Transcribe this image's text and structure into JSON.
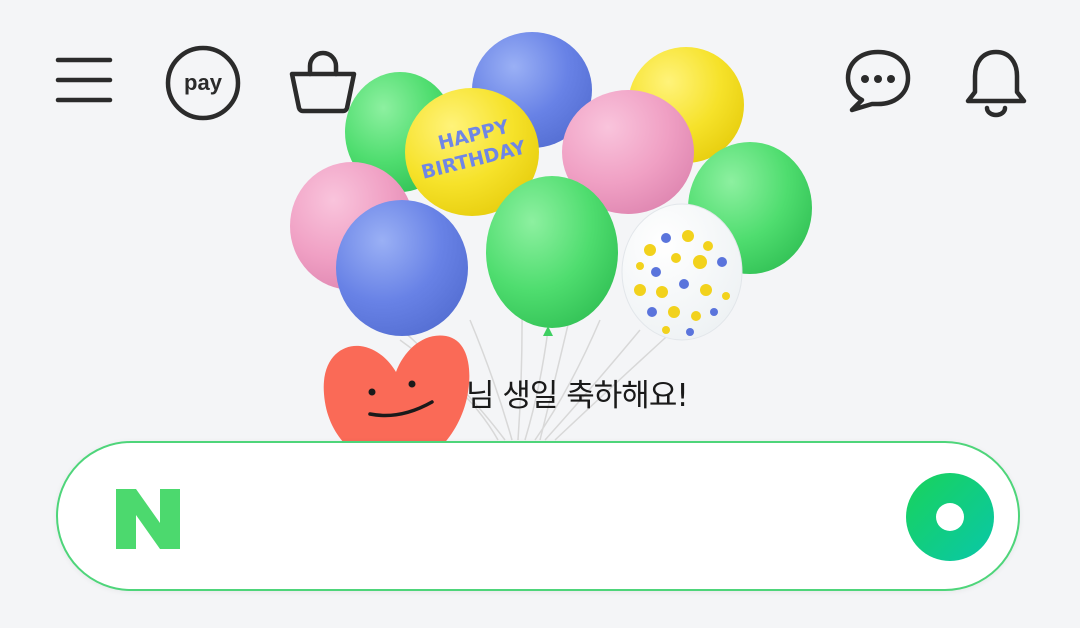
{
  "header": {
    "icons": [
      "menu-icon",
      "pay-icon",
      "shopping-bag-icon",
      "talk-bubble-icon",
      "bell-icon"
    ],
    "pay_label": "pay"
  },
  "banner": {
    "balloon_text": "HAPPY BIRTHDAY",
    "greeting": "님 생일 축하해요!"
  },
  "search": {
    "logo_letter": "N",
    "placeholder": "",
    "value": ""
  },
  "colors": {
    "background": "#f4f5f7",
    "brand_green": "#03c75a",
    "search_border": "#4ed57a",
    "icon_stroke": "#2b2b2b"
  }
}
